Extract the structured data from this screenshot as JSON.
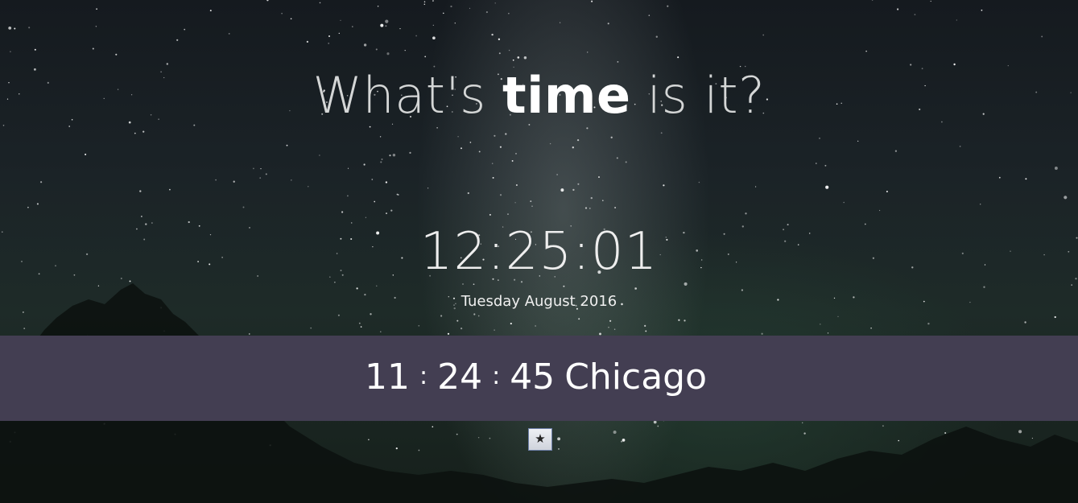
{
  "headline": {
    "before": "What's ",
    "emphasis": "time",
    "after": " is it?"
  },
  "local": {
    "time": "12:25:01",
    "date": "Tuesday August 2016"
  },
  "world_clock": {
    "hours": "11",
    "minutes": "24",
    "seconds": "45",
    "separator": ":",
    "city": "Chicago"
  },
  "favorite_button": {
    "icon": "star-icon",
    "glyph": "★"
  },
  "colors": {
    "band": "#433e52",
    "sky": "#1b2327"
  }
}
